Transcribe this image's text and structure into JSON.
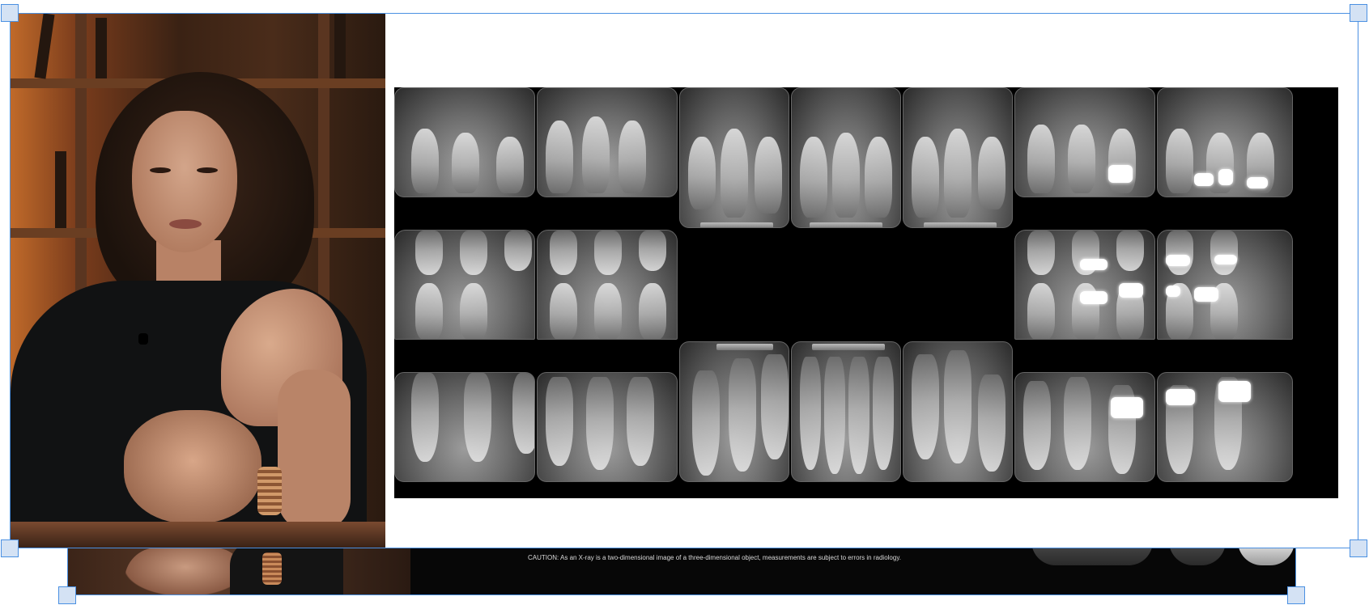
{
  "back_frame": {
    "caution_text": "CAUTION: As an X-ray is a two-dimensional image of a three-dimensional object, measurements are subject to errors in radiology."
  },
  "front_frame": {
    "video": {
      "subject": "presenter-video-frame"
    },
    "radiograph": {
      "type": "full-mouth-series",
      "rows": 3,
      "columns": 7
    }
  },
  "colors": {
    "selection": "#4a90e2",
    "handle_fill": "#d4e2f4",
    "xray_background": "#000000"
  }
}
